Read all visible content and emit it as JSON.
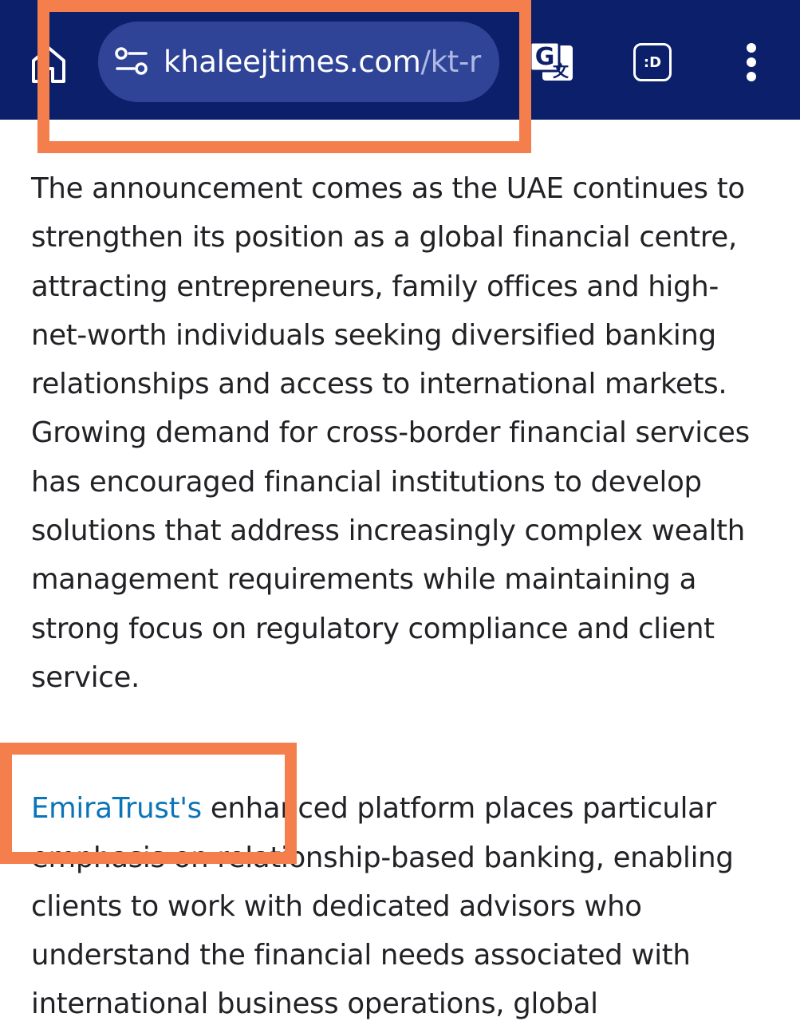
{
  "browser": {
    "url_domain": "khaleejtimes.com",
    "url_path": "/kt-r",
    "tabs_label": ":D",
    "toolbar_color": "#0c1f6b",
    "url_pill_color": "#2f4496",
    "icons": {
      "home": "home-icon",
      "site_settings": "site-settings-icon",
      "translate": "translate-icon",
      "tabs": "tab-switcher-icon",
      "menu": "more-vert-icon"
    }
  },
  "annotations": {
    "highlight_color": "#f47e4c"
  },
  "article": {
    "paragraph1": "The announcement comes as the UAE continues to strengthen its position as a global financial centre, attracting entrepreneurs, family offices and high-net-worth individuals seeking diversified banking relationships and access to international markets. Growing demand for cross-border financial services has encouraged financial institutions to develop solutions that address increasingly complex wealth management requirements while maintaining a strong focus on regulatory compliance and client service.",
    "paragraph2_link": "EmiraTrust's",
    "paragraph2_rest": " enhanced platform places particular emphasis on relationship-based banking, enabling clients to work with dedicated advisors who understand the financial needs associated with international business operations, global",
    "link_color": "#0a74b8"
  }
}
